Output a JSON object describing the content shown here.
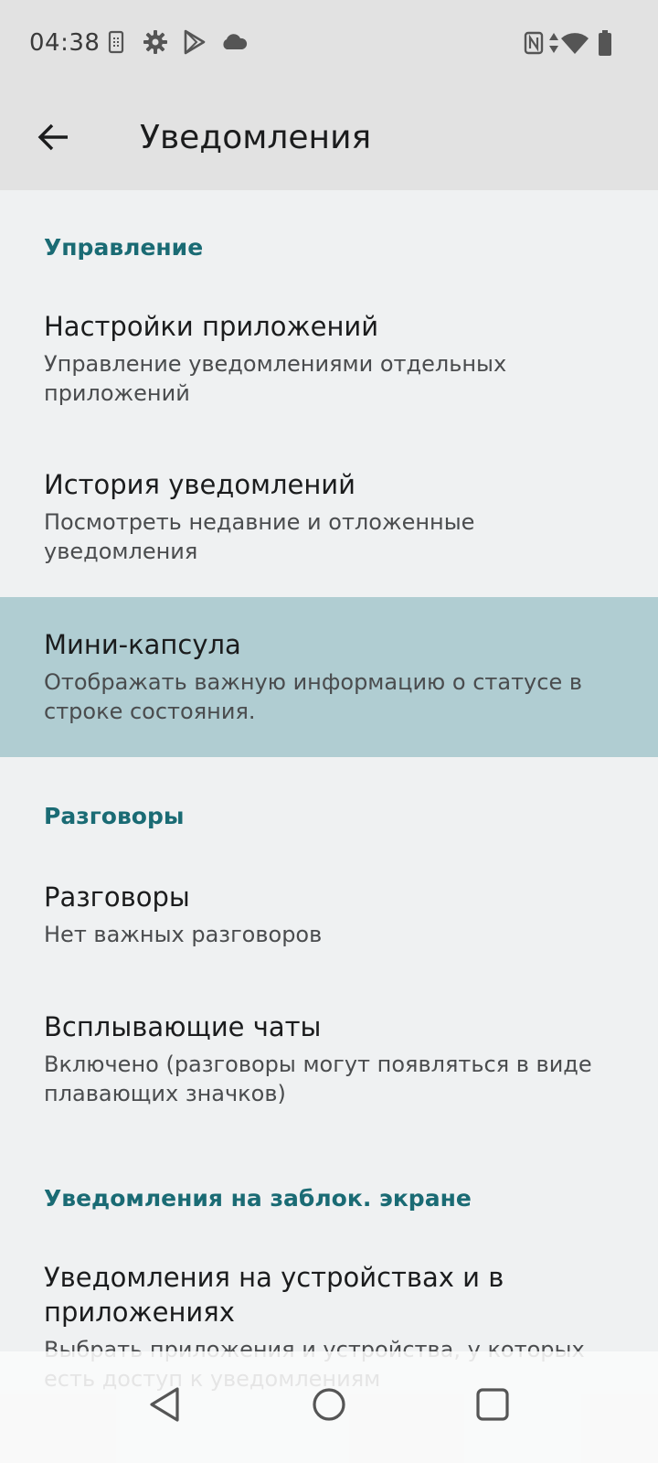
{
  "status_bar": {
    "time": "04:38",
    "icons_left": [
      "sim-card-icon",
      "settings-gear-icon",
      "play-store-icon",
      "cloud-icon"
    ],
    "icons_right": [
      "nfc-icon",
      "data-arrows-icon",
      "wifi-icon",
      "battery-icon"
    ]
  },
  "app_bar": {
    "back_icon": "arrow-back-icon",
    "title": "Уведомления"
  },
  "sections": {
    "management": {
      "header": "Управление",
      "app_settings": {
        "title": "Настройки приложений",
        "summary": "Управление уведомлениями отдельных приложений"
      },
      "history": {
        "title": "История уведомлений",
        "summary": "Посмотреть недавние и отложенные уведомления"
      },
      "mini_capsule": {
        "title": "Мини-капсула",
        "summary": "Отображать важную информацию о статусе в строке состояния."
      }
    },
    "conversations": {
      "header": "Разговоры",
      "conversations_item": {
        "title": "Разговоры",
        "summary": "Нет важных разговоров"
      },
      "bubbles": {
        "title": "Всплывающие чаты",
        "summary": "Включено (разговоры могут появляться в виде плавающих значков)"
      }
    },
    "lock_screen": {
      "header": "Уведомления на заблок. экране",
      "device_access": {
        "title": "Уведомления на устройствах и в приложениях",
        "summary": "Выбрать приложения и устройства, у которых есть доступ к уведомлениям"
      }
    }
  },
  "nav_bar": {
    "back": "nav-back-icon",
    "home": "nav-home-icon",
    "recents": "nav-recents-icon"
  },
  "colors": {
    "accent": "#1a6b74",
    "highlight": "#b0cdd2",
    "app_bar": "#e2e2e2",
    "background": "#eff1f2"
  }
}
